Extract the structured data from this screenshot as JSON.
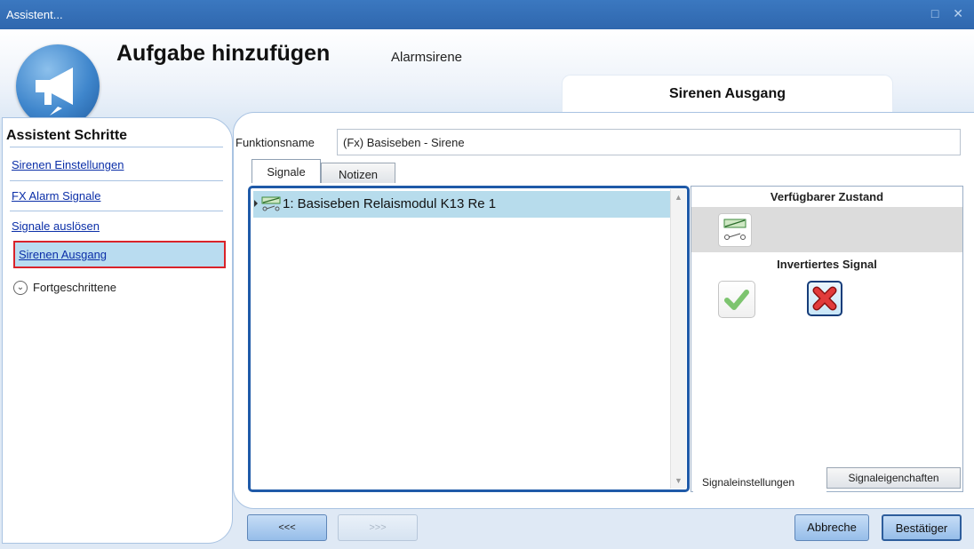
{
  "window": {
    "title": "Assistent...",
    "controls": "□ ✕"
  },
  "header": {
    "title": "Aufgabe hinzufügen",
    "subtitle": "Alarmsirene",
    "step_tab": "Sirenen Ausgang",
    "logo_icon": "megaphone-icon"
  },
  "sidebar": {
    "heading": "Assistent Schritte",
    "items": [
      {
        "label": "Sirenen Einstellungen"
      },
      {
        "label": "FX Alarm Signale"
      },
      {
        "label": "Signale auslösen"
      },
      {
        "label": "Sirenen Ausgang",
        "active": true
      }
    ],
    "advanced_label": "Fortgeschrittene"
  },
  "form": {
    "function_name_label": "Funktionsname",
    "function_name_value": "(Fx) Basiseben - Sirene",
    "tabs": [
      {
        "label": "Signale"
      },
      {
        "label": "Notizen"
      }
    ]
  },
  "signals": {
    "rows": [
      {
        "label": "1: Basiseben Relaismodul K13 Re 1",
        "icon": "relay-switch-icon"
      }
    ]
  },
  "right_panel": {
    "available_state_heading": "Verfügbarer Zustand",
    "inverted_signal_heading": "Invertiertes Signal",
    "tabs": [
      {
        "label": "Signaleinstellungen"
      },
      {
        "label": "Signaleigenchaften"
      }
    ]
  },
  "buttons": {
    "prev": "<<<",
    "next": ">>>",
    "cancel": "Abbreche",
    "confirm": "Bestätiger"
  },
  "colors": {
    "titlebar": "#2f67ae",
    "selection": "#b7dcec",
    "active_highlight_border": "#d9232a",
    "link": "#0b2fa8"
  }
}
